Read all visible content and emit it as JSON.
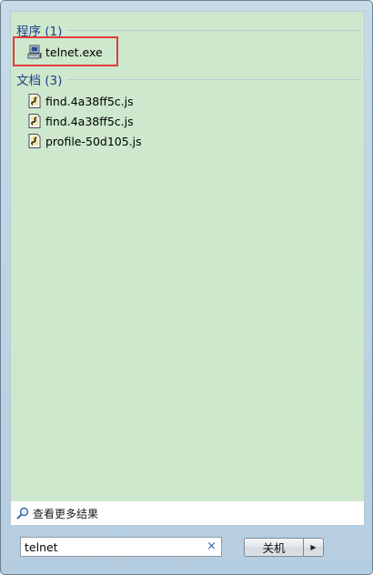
{
  "groups": [
    {
      "header": "程序 (1)",
      "items": [
        {
          "label": "telnet.exe",
          "icon": "terminal-program-icon"
        }
      ]
    },
    {
      "header": "文档 (3)",
      "items": [
        {
          "label": "find.4a38ff5c.js",
          "icon": "js-file-icon"
        },
        {
          "label": "find.4a38ff5c.js",
          "icon": "js-file-icon"
        },
        {
          "label": "profile-50d105.js",
          "icon": "js-file-icon"
        }
      ]
    }
  ],
  "more_results": {
    "label": "查看更多结果",
    "icon": "magnifier-icon"
  },
  "search": {
    "value": "telnet",
    "clear_glyph": "×"
  },
  "shutdown": {
    "label": "关机",
    "arrow_glyph": "▶"
  },
  "colors": {
    "results_bg": "#cde8cc",
    "header_text": "#1e3f8c",
    "highlight": "#e33b3b"
  }
}
